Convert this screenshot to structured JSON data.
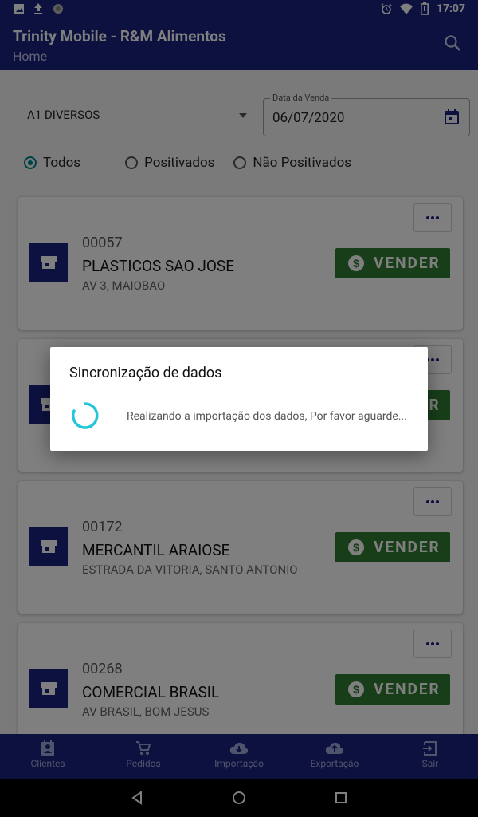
{
  "status_bar": {
    "time": "17:07",
    "battery_level": "low"
  },
  "app_bar": {
    "title": "Trinity Mobile - R&M Alimentos",
    "subtitle": "Home"
  },
  "filters": {
    "route": "A1 DIVERSOS",
    "date_label": "Data da Venda",
    "date_value": "06/07/2020",
    "radios": [
      {
        "label": "Todos",
        "checked": true
      },
      {
        "label": "Positivados",
        "checked": false
      },
      {
        "label": "Não Positivados",
        "checked": false
      }
    ]
  },
  "clients": [
    {
      "code": "00057",
      "name": "PLASTICOS SAO JOSE",
      "address": "AV 3, MAIOBAO",
      "action": "VENDER"
    },
    {
      "code": "",
      "name": "",
      "address": "",
      "action": "VENDER"
    },
    {
      "code": "00172",
      "name": "MERCANTIL ARAIOSE",
      "address": "ESTRADA DA VITORIA, SANTO ANTONIO",
      "action": "VENDER"
    },
    {
      "code": "00268",
      "name": "COMERCIAL BRASIL",
      "address": "AV BRASIL, BOM JESUS",
      "action": "VENDER"
    }
  ],
  "dialog": {
    "title": "Sincronização de dados",
    "message": "Realizando a importação dos dados, Por favor aguarde..."
  },
  "bottom_nav": [
    {
      "label": "Clientes",
      "icon": "contacts-icon"
    },
    {
      "label": "Pedidos",
      "icon": "cart-icon"
    },
    {
      "label": "Importação",
      "icon": "cloud-download-icon"
    },
    {
      "label": "Exportação",
      "icon": "cloud-upload-icon"
    },
    {
      "label": "Sair",
      "icon": "exit-icon"
    }
  ],
  "colors": {
    "primary": "#1a237e",
    "accent": "#00838f",
    "sell_button": "#2e7d32",
    "spinner": "#26c6da"
  }
}
